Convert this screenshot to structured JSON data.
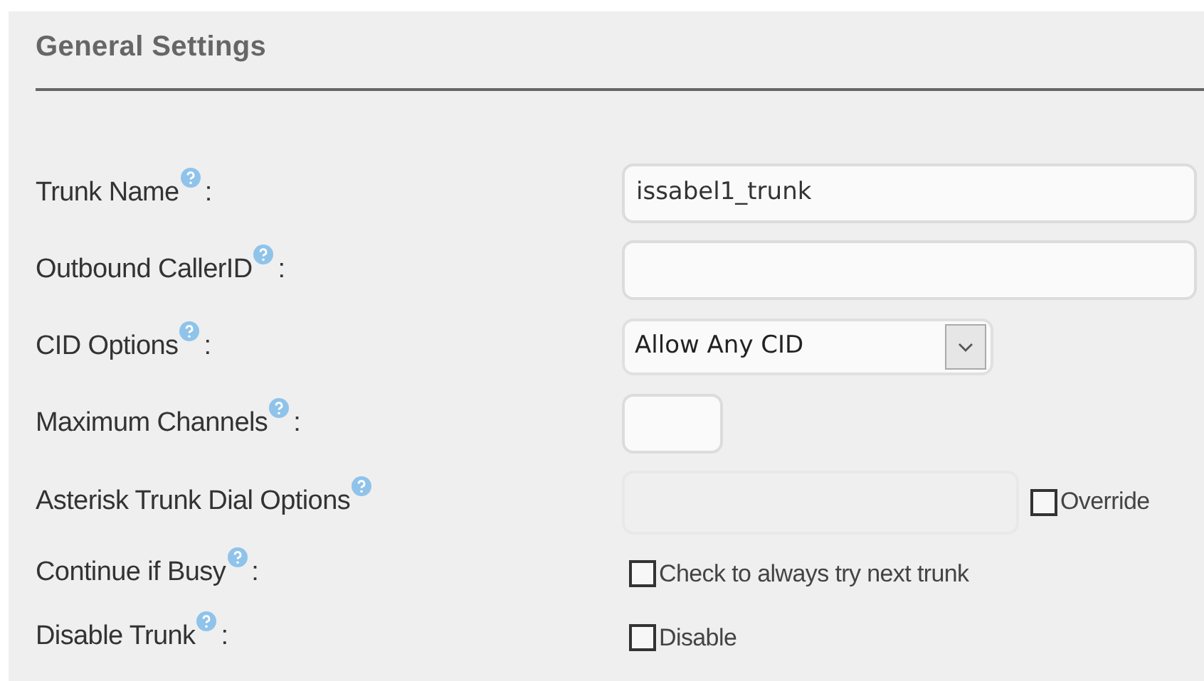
{
  "panel": {
    "title": "General Settings"
  },
  "rows": [
    {
      "label": "Trunk Name",
      "suffix": ":",
      "kind": "text",
      "value": "issabel1_trunk",
      "disabled": false
    },
    {
      "label": "Outbound CallerID",
      "suffix": ":",
      "kind": "text",
      "value": "",
      "disabled": false
    },
    {
      "label": "CID Options",
      "suffix": ":",
      "kind": "select",
      "value": "Allow Any CID"
    },
    {
      "label": "Maximum Channels",
      "suffix": ":",
      "kind": "short_text",
      "value": "",
      "disabled": false
    },
    {
      "label": "Asterisk Trunk Dial Options",
      "kind": "text_override",
      "value": "",
      "disabled": true,
      "checkbox": {
        "label": "Override",
        "checked": false
      }
    },
    {
      "label": "Continue if Busy",
      "suffix": ":",
      "kind": "checkbox",
      "checkbox": {
        "label": "Check to always try next trunk",
        "checked": false
      }
    },
    {
      "label": "Disable Trunk",
      "suffix": ":",
      "kind": "checkbox",
      "checkbox": {
        "label": "Disable",
        "checked": false
      }
    }
  ]
}
